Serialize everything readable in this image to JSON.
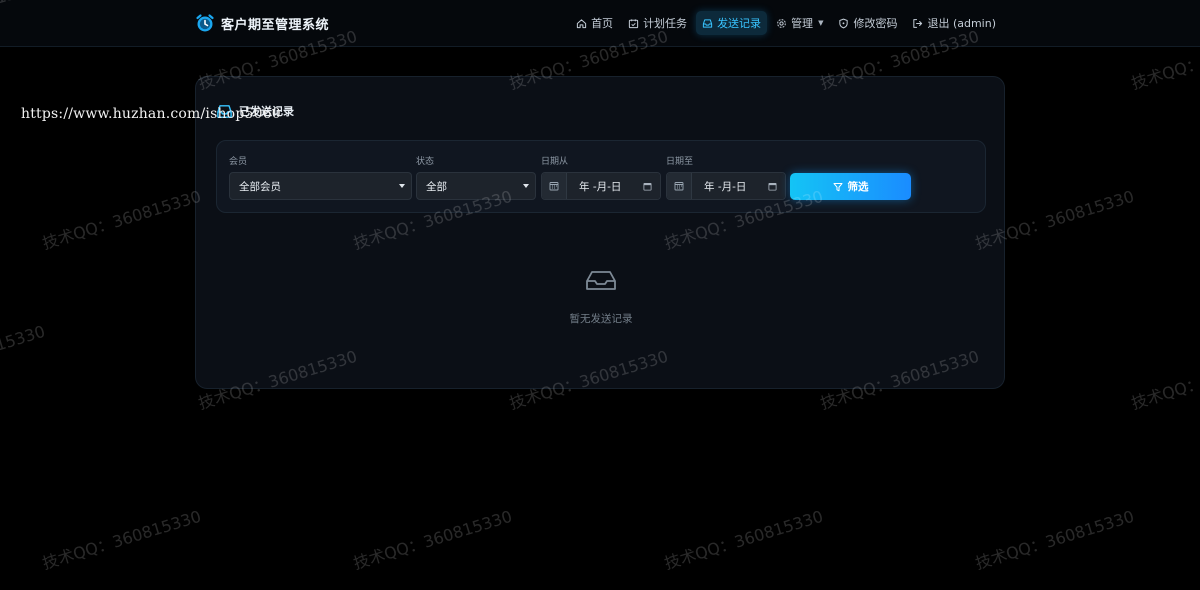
{
  "app": {
    "title": "客户期至管理系统"
  },
  "nav": {
    "home": "首页",
    "tasks": "计划任务",
    "records": "发送记录",
    "manage": "管理",
    "password": "修改密码",
    "logout": "退出 (admin)"
  },
  "card": {
    "title": "已发送记录"
  },
  "filters": {
    "member_label": "会员",
    "member_value": "全部会员",
    "status_label": "状态",
    "status_value": "全部",
    "date_from_label": "日期从",
    "date_from_value": "年 -月-日",
    "date_to_label": "日期至",
    "date_to_value": "年 -月-日",
    "filter_button": "筛选"
  },
  "empty_state": {
    "text": "暂无发送记录"
  },
  "overlay": {
    "url": "https://www.huzhan.com/ishop5060",
    "watermark": "技术QQ：360815330"
  },
  "colors": {
    "accent": "#1a8cff",
    "accent_cyan": "#14c4f5",
    "background": "#000000",
    "card": "#0b0f16"
  }
}
